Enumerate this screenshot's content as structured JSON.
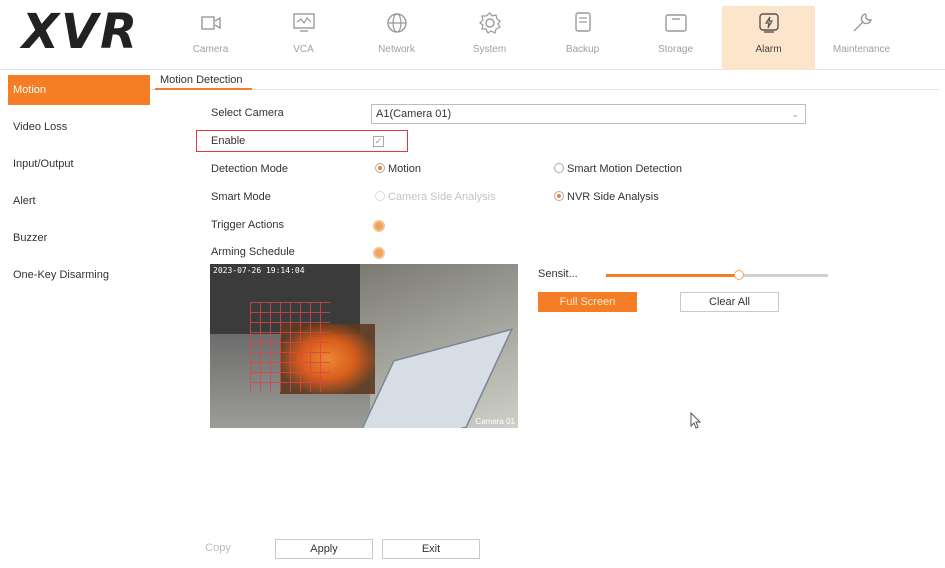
{
  "app": {
    "logo": "XVR"
  },
  "nav": [
    {
      "label": "Camera",
      "icon": "camera-icon"
    },
    {
      "label": "VCA",
      "icon": "vca-icon"
    },
    {
      "label": "Network",
      "icon": "network-globe-icon"
    },
    {
      "label": "System",
      "icon": "system-gear-icon"
    },
    {
      "label": "Backup",
      "icon": "backup-icon"
    },
    {
      "label": "Storage",
      "icon": "storage-icon"
    },
    {
      "label": "Alarm",
      "icon": "alarm-icon",
      "active": true
    },
    {
      "label": "Maintenance",
      "icon": "wrench-icon"
    }
  ],
  "sidebar": {
    "items": [
      {
        "label": "Motion",
        "active": true
      },
      {
        "label": "Video Loss"
      },
      {
        "label": "Input/Output"
      },
      {
        "label": "Alert"
      },
      {
        "label": "Buzzer"
      },
      {
        "label": "One-Key Disarming"
      }
    ]
  },
  "section": {
    "title": "Motion Detection"
  },
  "form": {
    "select_camera_label": "Select Camera",
    "select_camera_value": "A1(Camera 01)",
    "enable_label": "Enable",
    "enable_checked": true,
    "detection_mode_label": "Detection Mode",
    "detection_mode_options": [
      "Motion",
      "Smart Motion Detection"
    ],
    "smart_mode_label": "Smart Mode",
    "smart_mode_options": [
      "Camera Side Analysis",
      "NVR Side Analysis"
    ],
    "trigger_actions_label": "Trigger Actions",
    "arming_schedule_label": "Arming Schedule"
  },
  "video": {
    "timestamp": "2023-07-26 19:14:04",
    "camera_label": "Camera 01"
  },
  "sensitivity": {
    "label": "Sensit...",
    "level": 0.6
  },
  "buttons": {
    "full_screen": "Full Screen",
    "clear_all": "Clear All",
    "copy": "Copy",
    "apply": "Apply",
    "exit": "Exit"
  },
  "colors": {
    "accent": "#f47d26",
    "highlight_border": "#e03a3a",
    "active_nav_bg": "#fde5cc"
  }
}
